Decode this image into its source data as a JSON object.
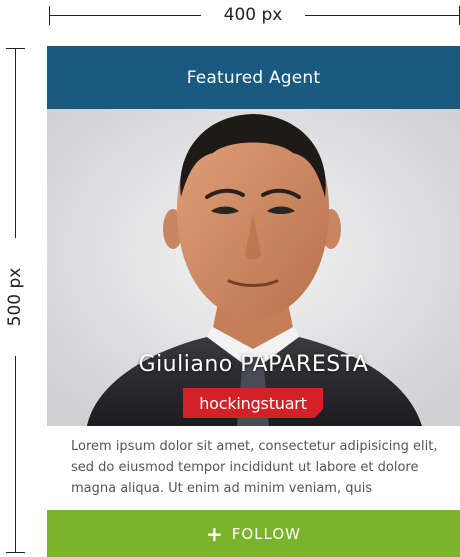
{
  "dimensions": {
    "width_label": "400 px",
    "height_label": "500 px"
  },
  "card": {
    "header_title": "Featured Agent",
    "agent_name": "Giuliano PAPARESTA",
    "agency": "hockingstuart",
    "bio": "Lorem ipsum dolor sit amet, consectetur adipisicing elit, sed do eiusmod tempor incididunt ut labore et dolore magna aliqua. Ut enim ad minim veniam, quis",
    "follow_icon": "+",
    "follow_label": "FOLLOW"
  },
  "colors": {
    "header_bg": "#1a5a80",
    "badge_bg": "#d42027",
    "follow_bg": "#79b42a",
    "bio_text": "#555555"
  },
  "icons": {
    "follow": "plus-icon"
  }
}
